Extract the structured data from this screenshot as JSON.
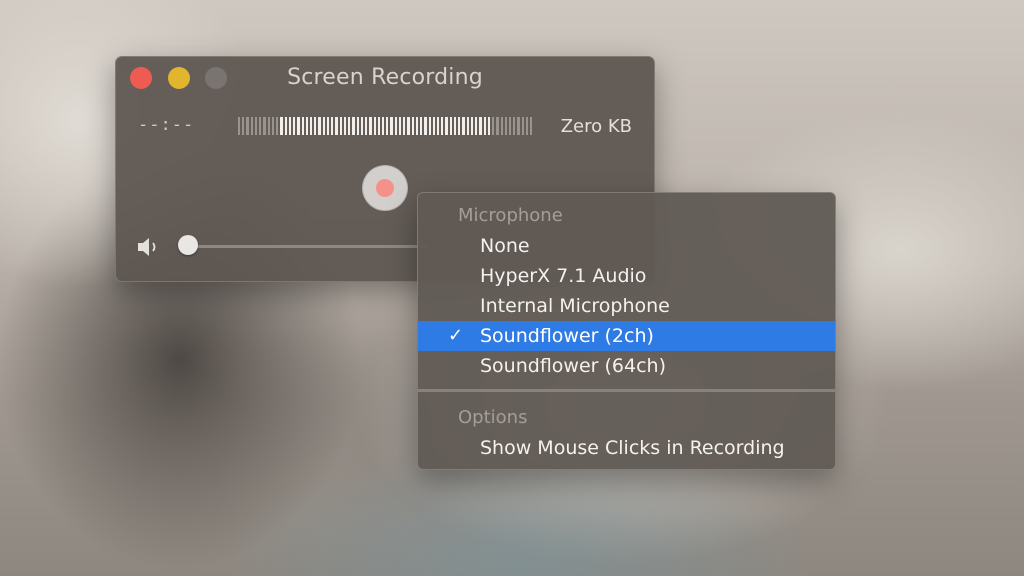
{
  "window": {
    "title": "Screen Recording",
    "time": "--:--",
    "file_size": "Zero KB"
  },
  "menu": {
    "microphone_header": "Microphone",
    "microphone_items": [
      {
        "label": "None",
        "selected": false
      },
      {
        "label": "HyperX 7.1 Audio",
        "selected": false
      },
      {
        "label": "Internal Microphone",
        "selected": false
      },
      {
        "label": "Soundflower (2ch)",
        "selected": true
      },
      {
        "label": "Soundflower (64ch)",
        "selected": false
      }
    ],
    "check_mark": "✓",
    "options_header": "Options",
    "options_items": [
      {
        "label": "Show Mouse Clicks in Recording"
      }
    ]
  },
  "colors": {
    "selection": "#2f7be6",
    "close": "#ee5b52",
    "minimize": "#e2b52f",
    "record_dot": "#f4918a"
  },
  "icons": [
    "close-icon",
    "minimize-icon",
    "zoom-icon",
    "record-icon",
    "speaker-icon",
    "checkmark-icon"
  ]
}
